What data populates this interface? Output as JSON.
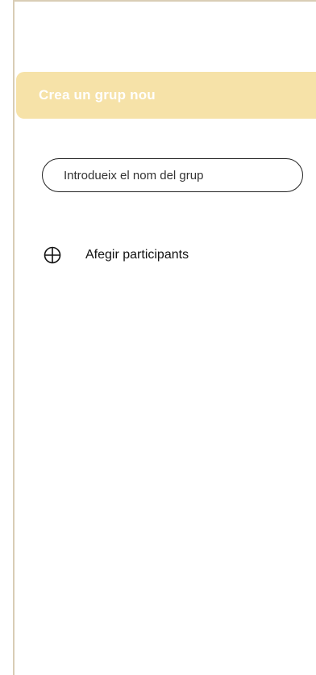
{
  "header": {
    "title": "Crea un grup nou",
    "background_color": "#f6e2a8"
  },
  "group_name": {
    "placeholder": "Introdueix el nom del grup",
    "value": ""
  },
  "add_participants": {
    "icon": "plus-circle-icon",
    "label": "Afegir participants"
  }
}
